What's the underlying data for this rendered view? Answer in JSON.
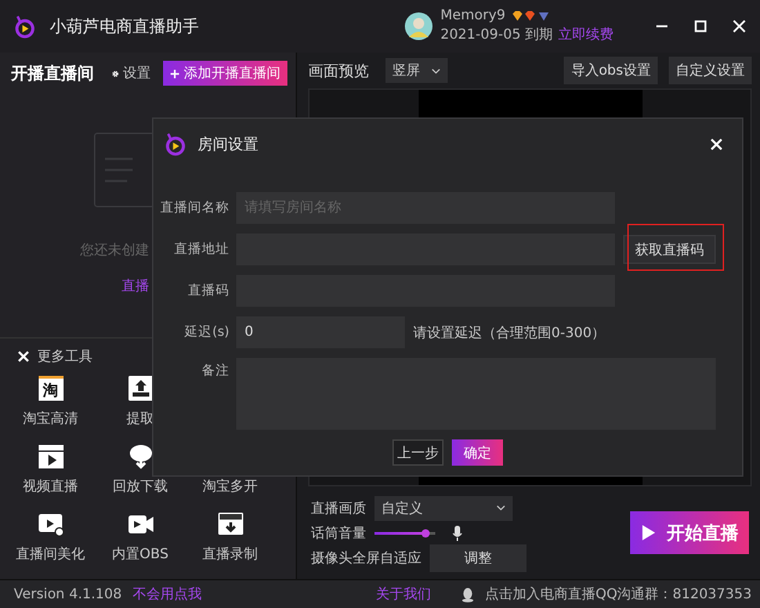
{
  "app": {
    "title": "小葫芦电商直播助手"
  },
  "user": {
    "name": "Memory9",
    "expiry": "2021-09-05 到期",
    "renew_link": "立即续费"
  },
  "left_panel": {
    "title": "开播直播间",
    "settings": "设置",
    "add_button": "添加开播直播间",
    "empty_text": "您还未创建",
    "empty_link": "直播"
  },
  "tools": {
    "title": "更多工具",
    "rows": [
      [
        {
          "label": "淘宝高清",
          "kind": "tao",
          "icon_text": "淘"
        },
        {
          "label": "提取",
          "kind": "upload"
        }
      ],
      [
        {
          "label": "视频直播",
          "kind": "clapper"
        },
        {
          "label": "回放下载",
          "kind": "download"
        },
        {
          "label": "淘宝多开",
          "kind": "plain"
        }
      ],
      [
        {
          "label": "直播间美化",
          "kind": "tv"
        },
        {
          "label": "内置OBS",
          "kind": "camera"
        },
        {
          "label": "直播录制",
          "kind": "rec"
        }
      ]
    ]
  },
  "preview": {
    "title": "画面预览",
    "orientation": "竖屏",
    "buttons": [
      "导入obs设置",
      "自定义设置"
    ]
  },
  "controls": {
    "quality_label": "直播画质",
    "quality": "自定义",
    "mic_label": "话筒音量",
    "mic": {
      "level": 0.85
    },
    "camera_label": "摄像头全屏自适应",
    "adjust_button": "调整",
    "start_button": "开始直播"
  },
  "dialog": {
    "title": "房间设置",
    "fields": [
      {
        "label": "直播间名称",
        "kind": "text",
        "placeholder": "请填写房间名称"
      },
      {
        "label": "直播地址",
        "kind": "text",
        "action": "获取直播码",
        "highlighted": true
      },
      {
        "label": "直播码",
        "kind": "text"
      },
      {
        "label": "延迟(s)",
        "kind": "short",
        "value": "0",
        "hint": "请设置延迟（合理范围0-300）"
      },
      {
        "label": "备注",
        "kind": "textarea"
      }
    ],
    "buttons": [
      {
        "label": "上一步",
        "primary": false
      },
      {
        "label": "确定",
        "primary": true
      }
    ]
  },
  "footer": {
    "version": "Version 4.1.108",
    "help_link": "不会用点我",
    "about_link": "关于我们",
    "group_text": "点击加入电商直播QQ沟通群：812037353"
  }
}
